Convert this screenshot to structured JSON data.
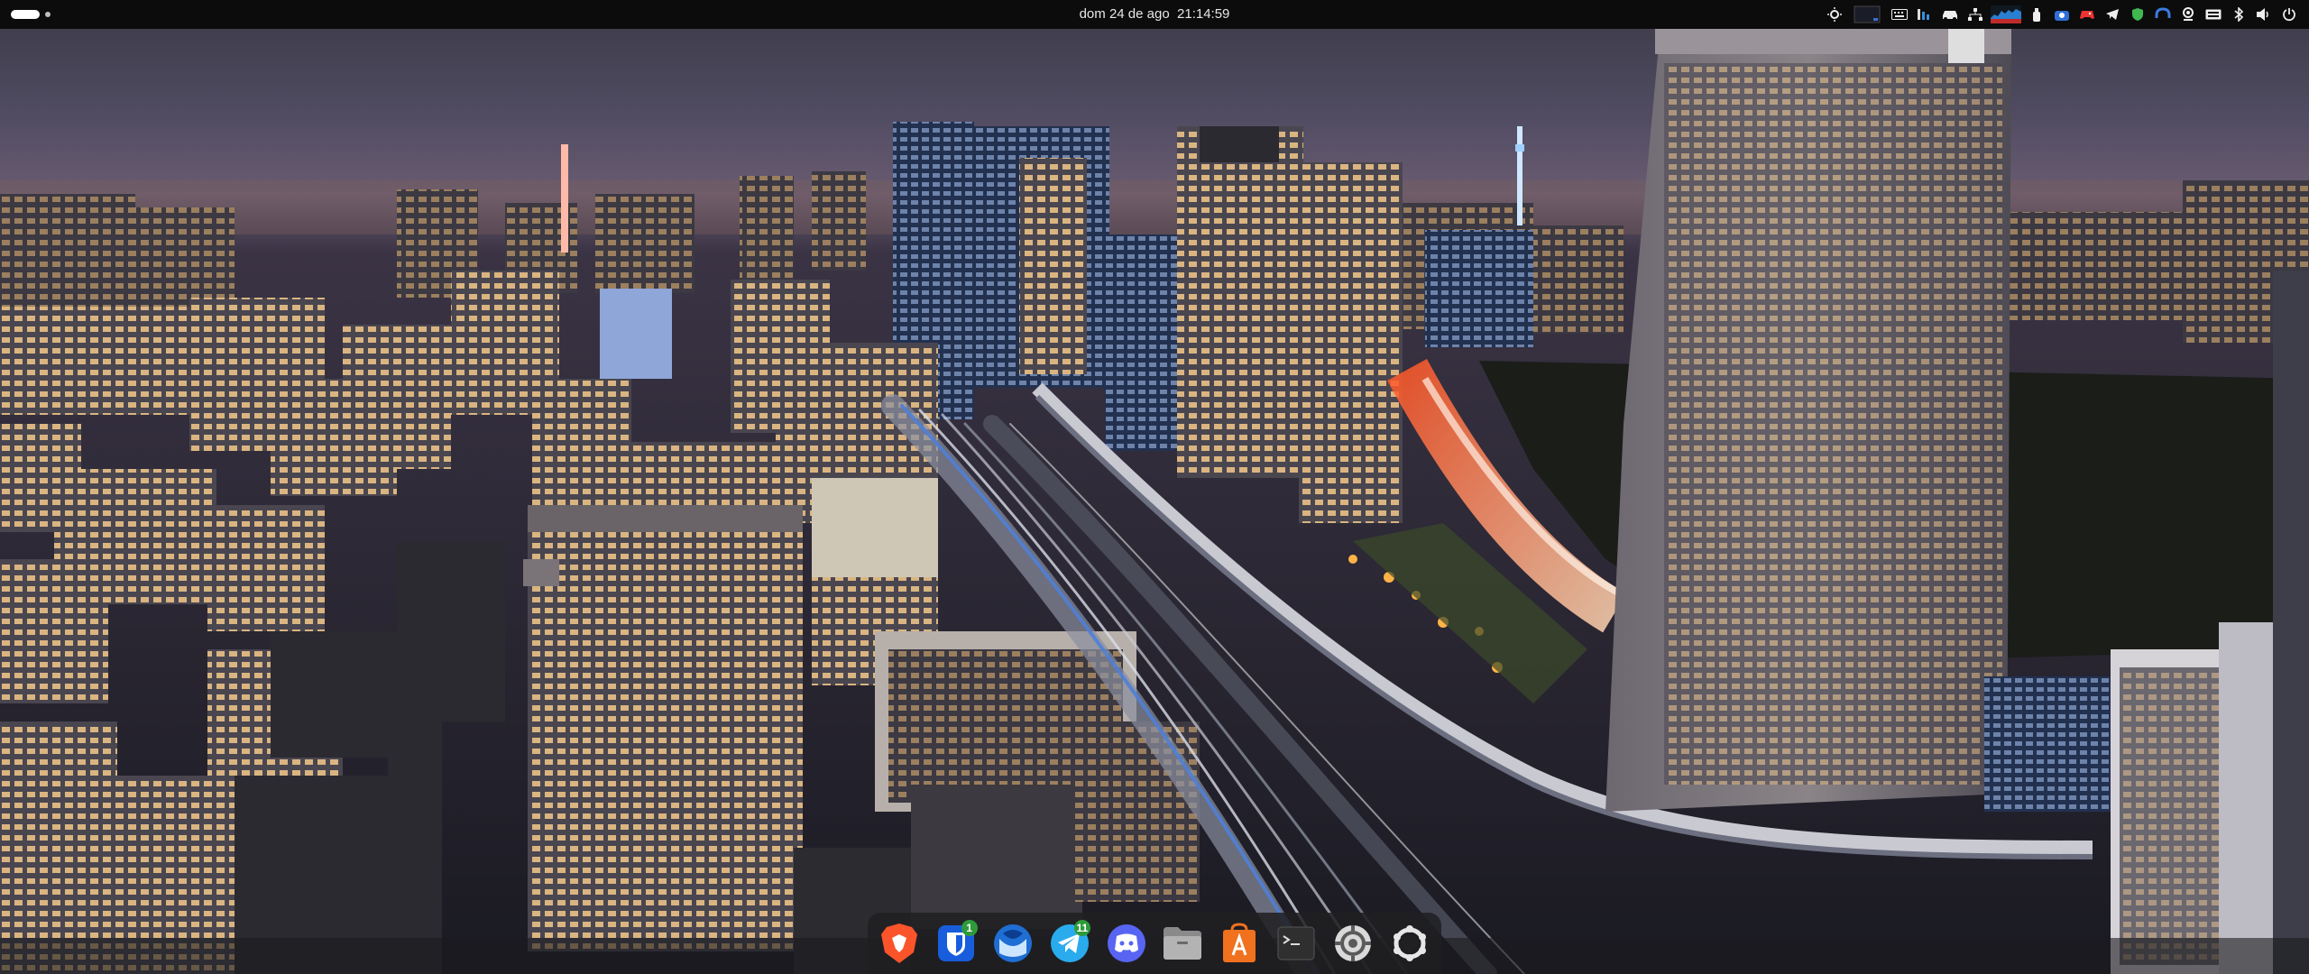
{
  "topbar": {
    "clock": {
      "date": "dom 24 de ago",
      "time": "21:14:59"
    },
    "tray_icons": [
      "brightness-icon",
      "display-indicator-icon",
      "keyboard-icon",
      "memory-meter-icon",
      "car-icon",
      "network-tree-icon",
      "cpu-graph-icon",
      "usb-drive-icon",
      "vpn-icon",
      "games-icon",
      "telegram-icon",
      "shield-icon",
      "headset-icon",
      "webcam-icon",
      "keyboard-layout-icon",
      "bluetooth-icon",
      "volume-icon",
      "power-icon"
    ]
  },
  "dock": {
    "items": [
      {
        "name": "brave-browser-icon",
        "badge": ""
      },
      {
        "name": "bitwarden-icon",
        "badge": "1"
      },
      {
        "name": "thunderbird-icon",
        "badge": ""
      },
      {
        "name": "telegram-app-icon",
        "badge": "11"
      },
      {
        "name": "discord-icon",
        "badge": ""
      },
      {
        "name": "files-icon",
        "badge": ""
      },
      {
        "name": "software-store-icon",
        "badge": ""
      },
      {
        "name": "terminal-icon",
        "badge": ""
      },
      {
        "name": "settings-icon",
        "badge": ""
      },
      {
        "name": "app-grid-icon",
        "badge": ""
      }
    ],
    "badges": {
      "bitwarden": "1",
      "telegram": "11"
    }
  },
  "colors": {
    "topbar_bg": "#0c0c0c",
    "dock_bg": "#202022",
    "badge_green": "#2e9b3b",
    "sky": "#4a4658",
    "city_glow": "#e8b070"
  }
}
